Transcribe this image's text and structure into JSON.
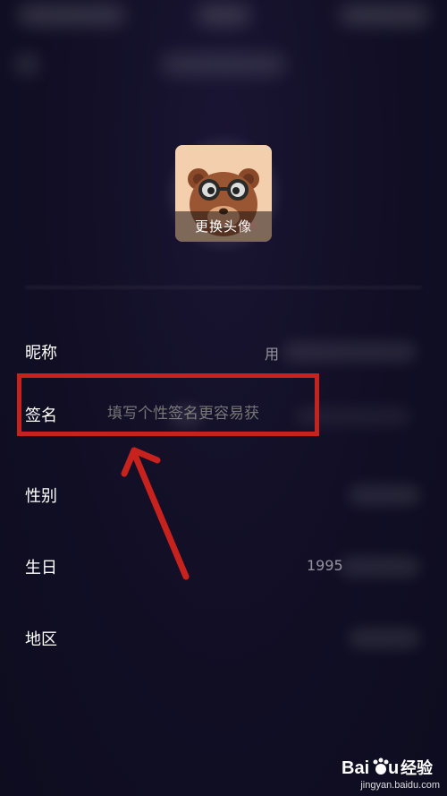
{
  "avatar": {
    "change_label": "更换头像"
  },
  "form": {
    "nickname": {
      "label": "昵称",
      "value_visible": "用"
    },
    "signature": {
      "label": "签名",
      "placeholder": "填写个性签名更容易获"
    },
    "gender": {
      "label": "性别"
    },
    "birthday": {
      "label": "生日",
      "value_visible": "1995"
    },
    "region": {
      "label": "地区"
    }
  },
  "annotation": {
    "highlight_color": "#c8221f"
  },
  "watermark": {
    "logo": "Bai du 经验",
    "site": "jingyan.baidu.com"
  }
}
